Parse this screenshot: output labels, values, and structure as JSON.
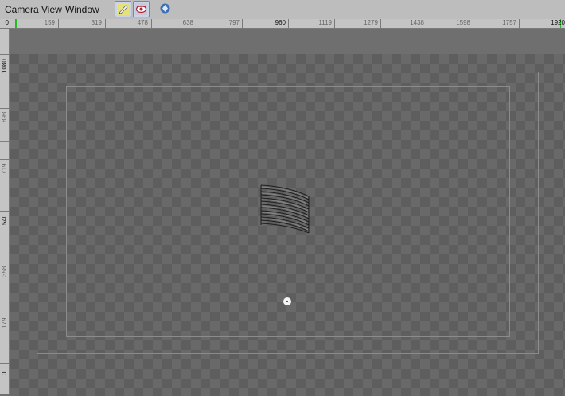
{
  "menu": [
    "Camera",
    "View",
    "Window"
  ],
  "toolbar": {
    "buttons": [
      {
        "name": "pencil-icon",
        "active": true
      },
      {
        "name": "eye-icon",
        "active": true
      },
      {
        "name": "blue-diamond-icon",
        "active": false
      }
    ]
  },
  "ruler_top": {
    "labels": [
      "0",
      "159",
      "319",
      "478",
      "638",
      "797",
      "960",
      "1119",
      "1279",
      "1438",
      "1598",
      "1757",
      "1920"
    ],
    "major": [
      "0",
      "960",
      "1920"
    ]
  },
  "ruler_left": {
    "labels": [
      "1080",
      "898",
      "719",
      "540",
      "358",
      "179",
      "0"
    ],
    "major": [
      "1080",
      "540",
      "0"
    ]
  },
  "colors": {
    "ruler_marker": "#1fc01f",
    "active_button": "#6b87c7"
  }
}
